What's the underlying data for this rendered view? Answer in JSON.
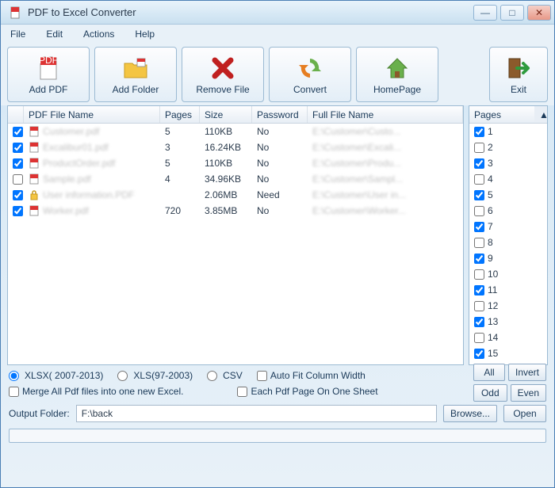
{
  "window": {
    "title": "PDF to Excel Converter"
  },
  "menu": {
    "file": "File",
    "edit": "Edit",
    "actions": "Actions",
    "help": "Help"
  },
  "toolbar": {
    "addpdf": "Add PDF",
    "addfolder": "Add Folder",
    "remove": "Remove File",
    "convert": "Convert",
    "homepage": "HomePage",
    "exit": "Exit"
  },
  "columns": {
    "name": "PDF File Name",
    "pages": "Pages",
    "size": "Size",
    "password": "Password",
    "full": "Full File Name",
    "pagescol": "Pages"
  },
  "files": [
    {
      "checked": true,
      "locked": false,
      "name": "Customer.pdf",
      "pages": "5",
      "size": "110KB",
      "pwd": "No",
      "full": "E:\\Customer\\Custo..."
    },
    {
      "checked": true,
      "locked": false,
      "name": "Excalibur01.pdf",
      "pages": "3",
      "size": "16.24KB",
      "pwd": "No",
      "full": "E:\\Customer\\Excali..."
    },
    {
      "checked": true,
      "locked": false,
      "name": "ProductOrder.pdf",
      "pages": "5",
      "size": "110KB",
      "pwd": "No",
      "full": "E:\\Customer\\Produ..."
    },
    {
      "checked": false,
      "locked": false,
      "name": "Sample.pdf",
      "pages": "4",
      "size": "34.96KB",
      "pwd": "No",
      "full": "E:\\Customer\\Sampl..."
    },
    {
      "checked": true,
      "locked": true,
      "name": "User information.PDF",
      "pages": "",
      "size": "2.06MB",
      "pwd": "Need",
      "full": "E:\\Customer\\User in..."
    },
    {
      "checked": true,
      "locked": false,
      "name": "Worker.pdf",
      "pages": "720",
      "size": "3.85MB",
      "pwd": "No",
      "full": "E:\\Customer\\Worker..."
    }
  ],
  "pages": [
    {
      "n": "1",
      "c": true
    },
    {
      "n": "2",
      "c": false
    },
    {
      "n": "3",
      "c": true
    },
    {
      "n": "4",
      "c": false
    },
    {
      "n": "5",
      "c": true
    },
    {
      "n": "6",
      "c": false
    },
    {
      "n": "7",
      "c": true
    },
    {
      "n": "8",
      "c": false
    },
    {
      "n": "9",
      "c": true
    },
    {
      "n": "10",
      "c": false
    },
    {
      "n": "11",
      "c": true
    },
    {
      "n": "12",
      "c": false
    },
    {
      "n": "13",
      "c": true
    },
    {
      "n": "14",
      "c": false
    },
    {
      "n": "15",
      "c": true
    }
  ],
  "opts": {
    "xlsx": "XLSX( 2007-2013)",
    "xls": "XLS(97-2003)",
    "csv": "CSV",
    "autofit": "Auto Fit Column Width",
    "merge": "Merge All Pdf files into one new Excel.",
    "eachpage": "Each Pdf Page On One Sheet"
  },
  "buttons": {
    "all": "All",
    "invert": "Invert",
    "odd": "Odd",
    "even": "Even",
    "browse": "Browse...",
    "open": "Open"
  },
  "output": {
    "label": "Output Folder:",
    "value": "F:\\back"
  }
}
